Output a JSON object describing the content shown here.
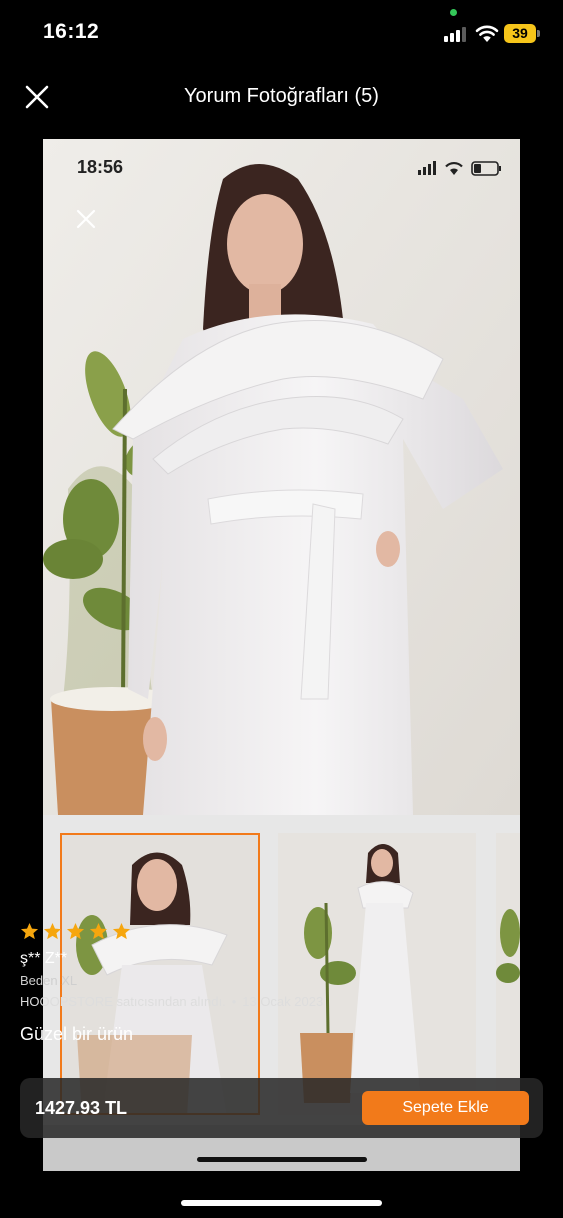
{
  "status_bar": {
    "time": "16:12",
    "battery": "39",
    "signal_bars": 3
  },
  "header": {
    "title": "Yorum Fotoğrafları (5)",
    "close_icon": "close-icon"
  },
  "photo": {
    "inner_status_time": "18:56",
    "inner_close_icon": "close-icon",
    "thumbnails": [
      {
        "selected": true
      },
      {
        "selected": false
      },
      {
        "selected": false
      }
    ]
  },
  "review": {
    "rating": 5,
    "star_color": "#f6a60e",
    "reviewer": "ş** Z**",
    "size": "Beden XL",
    "seller": "HOOOPSTORE satıcısından alındı.",
    "separator": "•",
    "date": "13 Ocak 2023",
    "text": "Güzel bir ürün"
  },
  "buy_bar": {
    "price": "1427.93 TL",
    "add_to_cart_label": "Sepete Ekle",
    "accent_color": "#f27a1a"
  }
}
